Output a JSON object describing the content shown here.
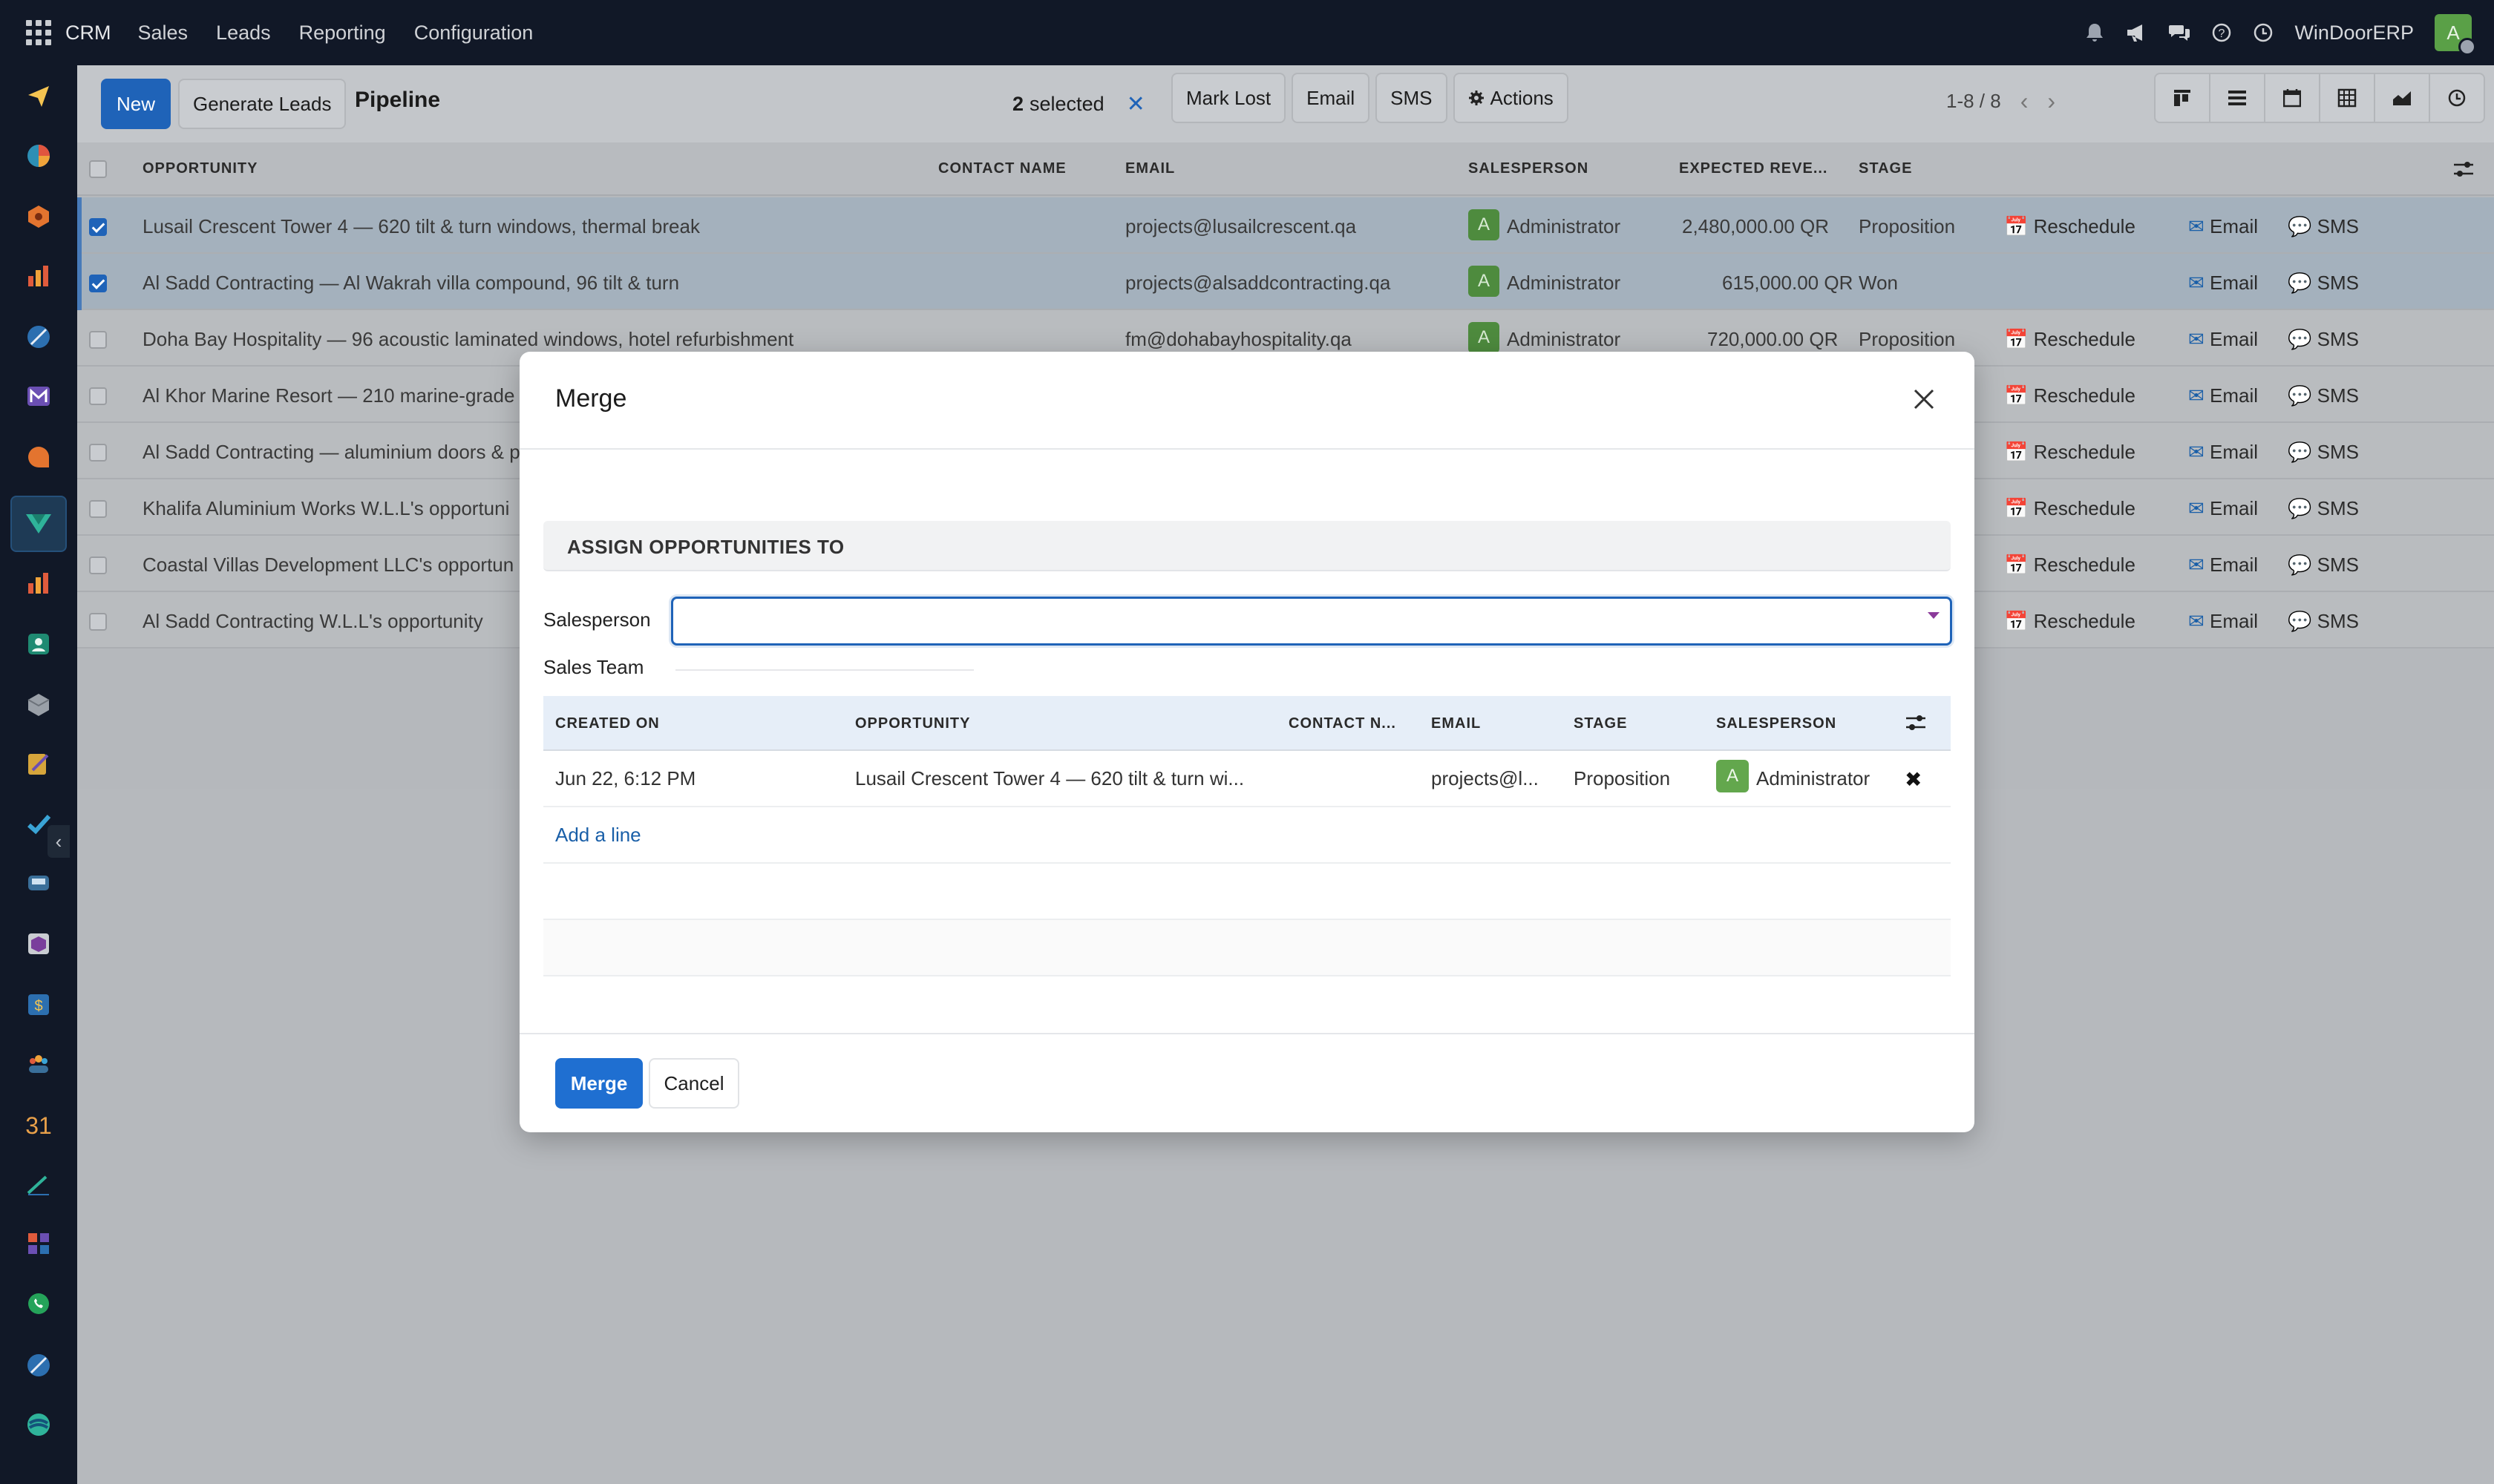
{
  "navbar": {
    "brand": "CRM",
    "menu": [
      "Sales",
      "Leads",
      "Reporting",
      "Configuration"
    ],
    "company": "WinDoorERP",
    "avatar": "A"
  },
  "control": {
    "new_label": "New",
    "generate_label": "Generate Leads",
    "title": "Pipeline",
    "selected_count": "2",
    "selected_text": "selected",
    "mark_lost": "Mark Lost",
    "email": "Email",
    "sms": "SMS",
    "actions": "Actions",
    "pager": "1-8 / 8"
  },
  "list": {
    "headers": {
      "opportunity": "OPPORTUNITY",
      "contact": "CONTACT NAME",
      "email": "EMAIL",
      "salesperson": "SALESPERSON",
      "revenue": "EXPECTED REVE...",
      "stage": "STAGE"
    },
    "rows": [
      {
        "name": "Lusail Crescent Tower 4 — 620 tilt & turn windows, thermal break",
        "email": "projects@lusailcrescent.qa",
        "sp": "Administrator",
        "rev": "2,480,000.00 QR",
        "stage": "Proposition",
        "resched": "Reschedule",
        "act_email": "Email",
        "act_sms": "SMS"
      },
      {
        "name": "Al Sadd Contracting — Al Wakrah villa compound, 96 tilt & turn",
        "email": "projects@alsaddcontracting.qa",
        "sp": "Administrator",
        "rev": "615,000.00 QR",
        "stage": "Won",
        "resched": "",
        "act_email": "Email",
        "act_sms": "SMS"
      },
      {
        "name": "Doha Bay Hospitality — 96 acoustic laminated windows, hotel refurbishment",
        "email": "fm@dohabayhospitality.qa",
        "sp": "Administrator",
        "rev": "720,000.00 QR",
        "stage": "Proposition",
        "resched": "Reschedule",
        "act_email": "Email",
        "act_sms": "SMS"
      },
      {
        "name": "Al Khor Marine Resort — 210 marine-grade",
        "resched": "Reschedule",
        "act_email": "Email",
        "act_sms": "SMS"
      },
      {
        "name": "Al Sadd Contracting — aluminium doors & p",
        "resched": "Reschedule",
        "act_email": "Email",
        "act_sms": "SMS"
      },
      {
        "name": "Khalifa Aluminium Works W.L.L's opportuni",
        "resched": "Reschedule",
        "act_email": "Email",
        "act_sms": "SMS"
      },
      {
        "name": "Coastal Villas Development LLC's opportun",
        "resched": "Reschedule",
        "act_email": "Email",
        "act_sms": "SMS"
      },
      {
        "name": "Al Sadd Contracting W.L.L's opportunity",
        "resched": "Reschedule",
        "act_email": "Email",
        "act_sms": "SMS"
      }
    ],
    "avatar": "A"
  },
  "modal": {
    "title": "Merge",
    "section": "ASSIGN OPPORTUNITIES TO",
    "salesperson_label": "Salesperson",
    "salesperson_value": "",
    "team_label": "Sales Team",
    "table": {
      "headers": {
        "created": "CREATED ON",
        "opportunity": "OPPORTUNITY",
        "contact": "CONTACT N...",
        "email": "EMAIL",
        "stage": "STAGE",
        "salesperson": "SALESPERSON"
      },
      "row": {
        "created": "Jun 22, 6:12 PM",
        "opportunity": "Lusail Crescent Tower 4 — 620 tilt & turn wi...",
        "email": "projects@l...",
        "stage": "Proposition",
        "avatar": "A",
        "salesperson": "Administrator"
      },
      "add_line": "Add a line"
    },
    "merge_label": "Merge",
    "cancel_label": "Cancel"
  },
  "colors": {
    "accent": "#1f63b8",
    "navbar": "#111827",
    "avatar_green": "#63a74d"
  }
}
